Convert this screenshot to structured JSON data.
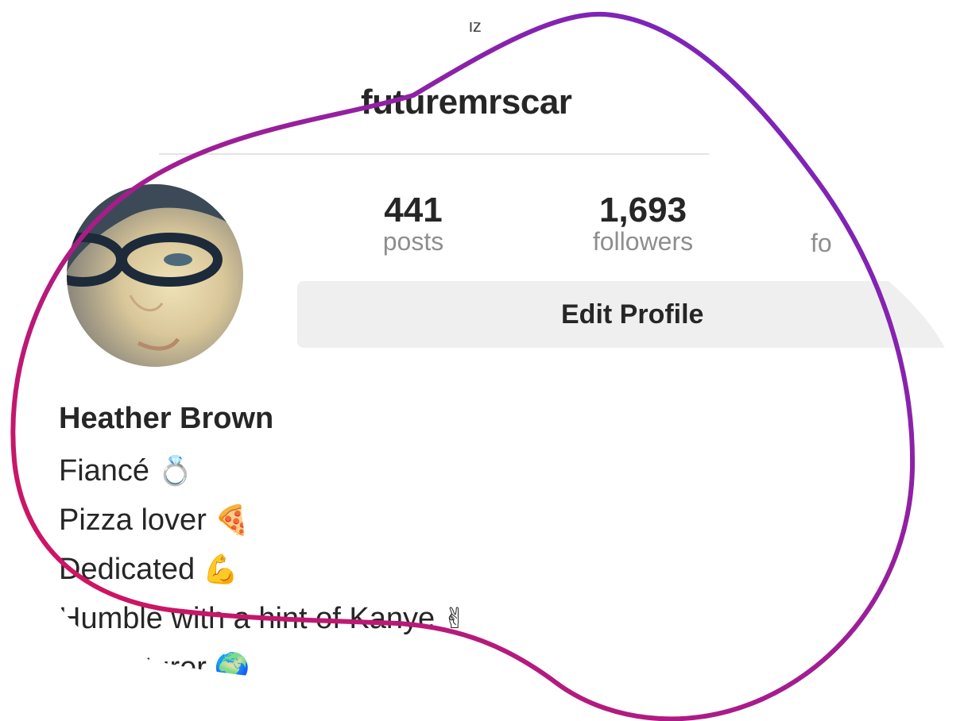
{
  "app": {
    "top_fragment": "iz"
  },
  "header": {
    "username": "futuremrscar"
  },
  "stats": {
    "posts": {
      "value": "441",
      "label": "posts"
    },
    "followers": {
      "value": "1,693",
      "label": "followers"
    },
    "following": {
      "label": "fo"
    }
  },
  "edit_button": {
    "label": "Edit Profile"
  },
  "profile": {
    "name": "Heather Brown",
    "bio": [
      {
        "text": "Fiancé",
        "emoji": "💍"
      },
      {
        "text": "Pizza lover",
        "emoji": "🍕"
      },
      {
        "text": "Dedicated",
        "emoji": "💪"
      },
      {
        "text": "Humble with a hint of Kanye",
        "emoji": "✌"
      },
      {
        "text": "Adventurer",
        "emoji": "🌍"
      }
    ]
  },
  "icons": {
    "avatar": "avatar-photo"
  },
  "colors": {
    "outline_start": "#e0114f",
    "outline_end": "#7a25c9",
    "text": "#262626",
    "muted": "#8e8e8e",
    "button_bg": "#efefef"
  }
}
